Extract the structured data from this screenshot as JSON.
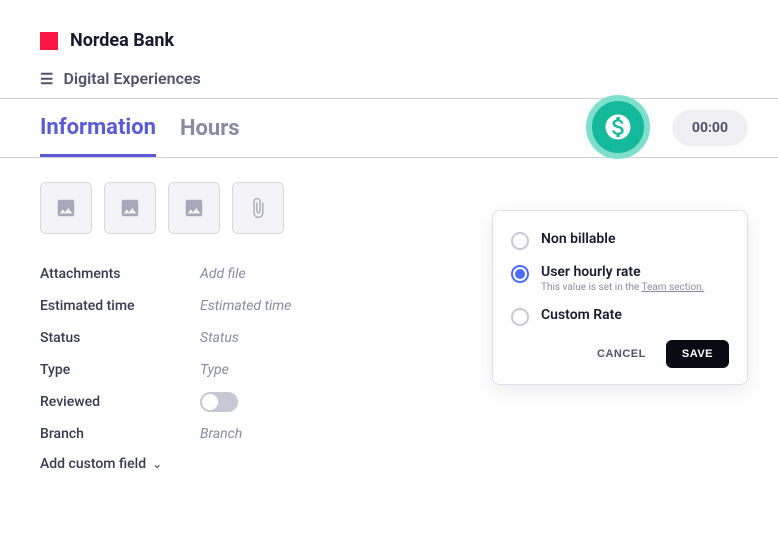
{
  "brand": {
    "name": "Nordea Bank"
  },
  "breadcrumb": {
    "label": "Digital Experiences"
  },
  "tabs": {
    "information": "Information",
    "hours": "Hours"
  },
  "timer": {
    "value": "00:00"
  },
  "fields": {
    "attachments": {
      "label": "Attachments",
      "value": "Add file"
    },
    "estimated_time": {
      "label": "Estimated time",
      "value": "Estimated time"
    },
    "status": {
      "label": "Status",
      "value": "Status"
    },
    "type": {
      "label": "Type",
      "value": "Type"
    },
    "reviewed": {
      "label": "Reviewed"
    },
    "branch": {
      "label": "Branch",
      "value": "Branch"
    }
  },
  "add_custom_label": "Add custom field",
  "rate_card": {
    "options": {
      "non_billable": "Non billable",
      "user_hourly": "User hourly rate",
      "user_hourly_help_prefix": "This value is set in the ",
      "user_hourly_help_link": "Team section.",
      "custom_rate": "Custom Rate"
    },
    "cancel": "CANCEL",
    "save": "SAVE"
  }
}
